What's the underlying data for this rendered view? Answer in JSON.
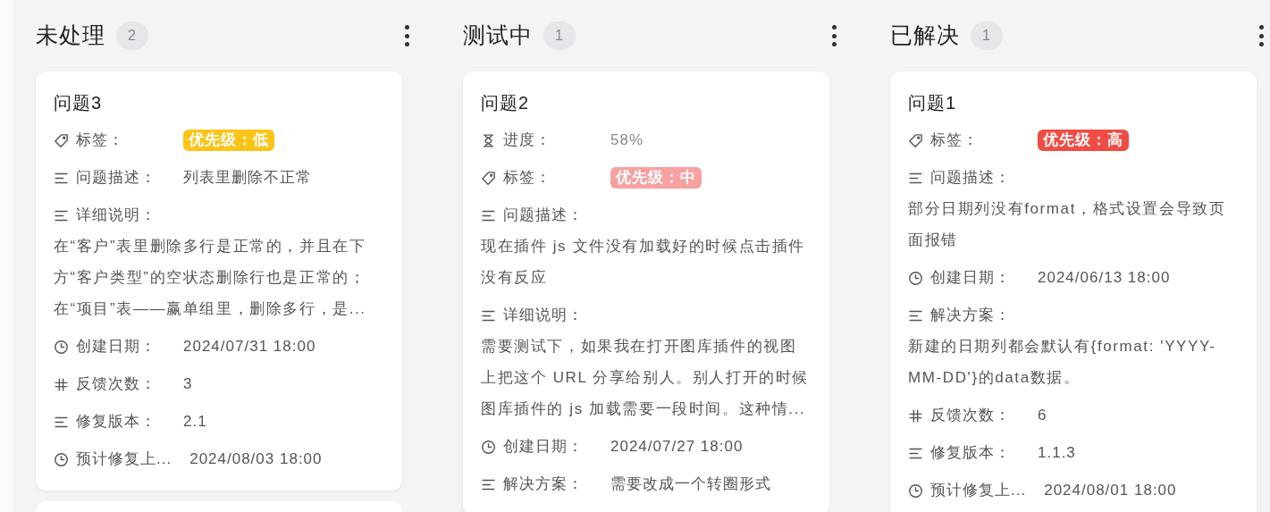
{
  "columns": [
    {
      "title": "未处理",
      "count": "2",
      "more_cards": true,
      "cards": [
        {
          "title": "问题3",
          "fields": [
            {
              "kind": "tag",
              "label": "标签：",
              "value": "优先级：低",
              "color": "#fcc419"
            },
            {
              "kind": "text",
              "label": "问题描述：",
              "value": "列表里删除不正常"
            },
            {
              "kind": "text_block",
              "label": "详细说明：",
              "value": "在“客户”表里删除多行是正常的，并且在下方“客户类型”的空状态删除行也是正常的；在“项目”表——赢单组里，删除多行，是..."
            },
            {
              "kind": "date",
              "label": "创建日期：",
              "value": "2024/07/31 18:00"
            },
            {
              "kind": "count",
              "label": "反馈次数：",
              "value": "3"
            },
            {
              "kind": "text",
              "label": "修复版本：",
              "value": "2.1"
            },
            {
              "kind": "date",
              "label": "预计修复上...",
              "value": "2024/08/03 18:00"
            }
          ]
        }
      ]
    },
    {
      "title": "测试中",
      "count": "1",
      "more_cards": false,
      "cards": [
        {
          "title": "问题2",
          "fields": [
            {
              "kind": "progress",
              "label": "进度：",
              "value": "58%"
            },
            {
              "kind": "tag",
              "label": "标签：",
              "value": "优先级：中",
              "color": "#f7a1a1"
            },
            {
              "kind": "text_block",
              "label": "问题描述：",
              "value": "现在插件 js 文件没有加载好的时候点击插件没有反应"
            },
            {
              "kind": "text_block",
              "label": "详细说明：",
              "value": "需要测试下，如果我在打开图库插件的视图上把这个 URL 分享给别人。别人打开的时候图库插件的 js 加载需要一段时间。这种情..."
            },
            {
              "kind": "date",
              "label": "创建日期：",
              "value": "2024/07/27 18:00"
            },
            {
              "kind": "text",
              "label": "解决方案：",
              "value": "需要改成一个转圈形式"
            }
          ]
        }
      ]
    },
    {
      "title": "已解决",
      "count": "1",
      "more_cards": false,
      "cards": [
        {
          "title": "问题1",
          "fields": [
            {
              "kind": "tag",
              "label": "标签：",
              "value": "优先级：高",
              "color": "#f04c43"
            },
            {
              "kind": "text_block",
              "label": "问题描述：",
              "value": "部分日期列没有format，格式设置会导致页面报错"
            },
            {
              "kind": "date",
              "label": "创建日期：",
              "value": "2024/06/13 18:00"
            },
            {
              "kind": "text_block",
              "label": "解决方案：",
              "value": "新建的日期列都会默认有{format: 'YYYY-MM-DD'}的data数据。"
            },
            {
              "kind": "count",
              "label": "反馈次数：",
              "value": "6"
            },
            {
              "kind": "text",
              "label": "修复版本：",
              "value": "1.1.3"
            },
            {
              "kind": "date",
              "label": "预计修复上...",
              "value": "2024/08/01 18:00"
            }
          ]
        }
      ]
    }
  ]
}
